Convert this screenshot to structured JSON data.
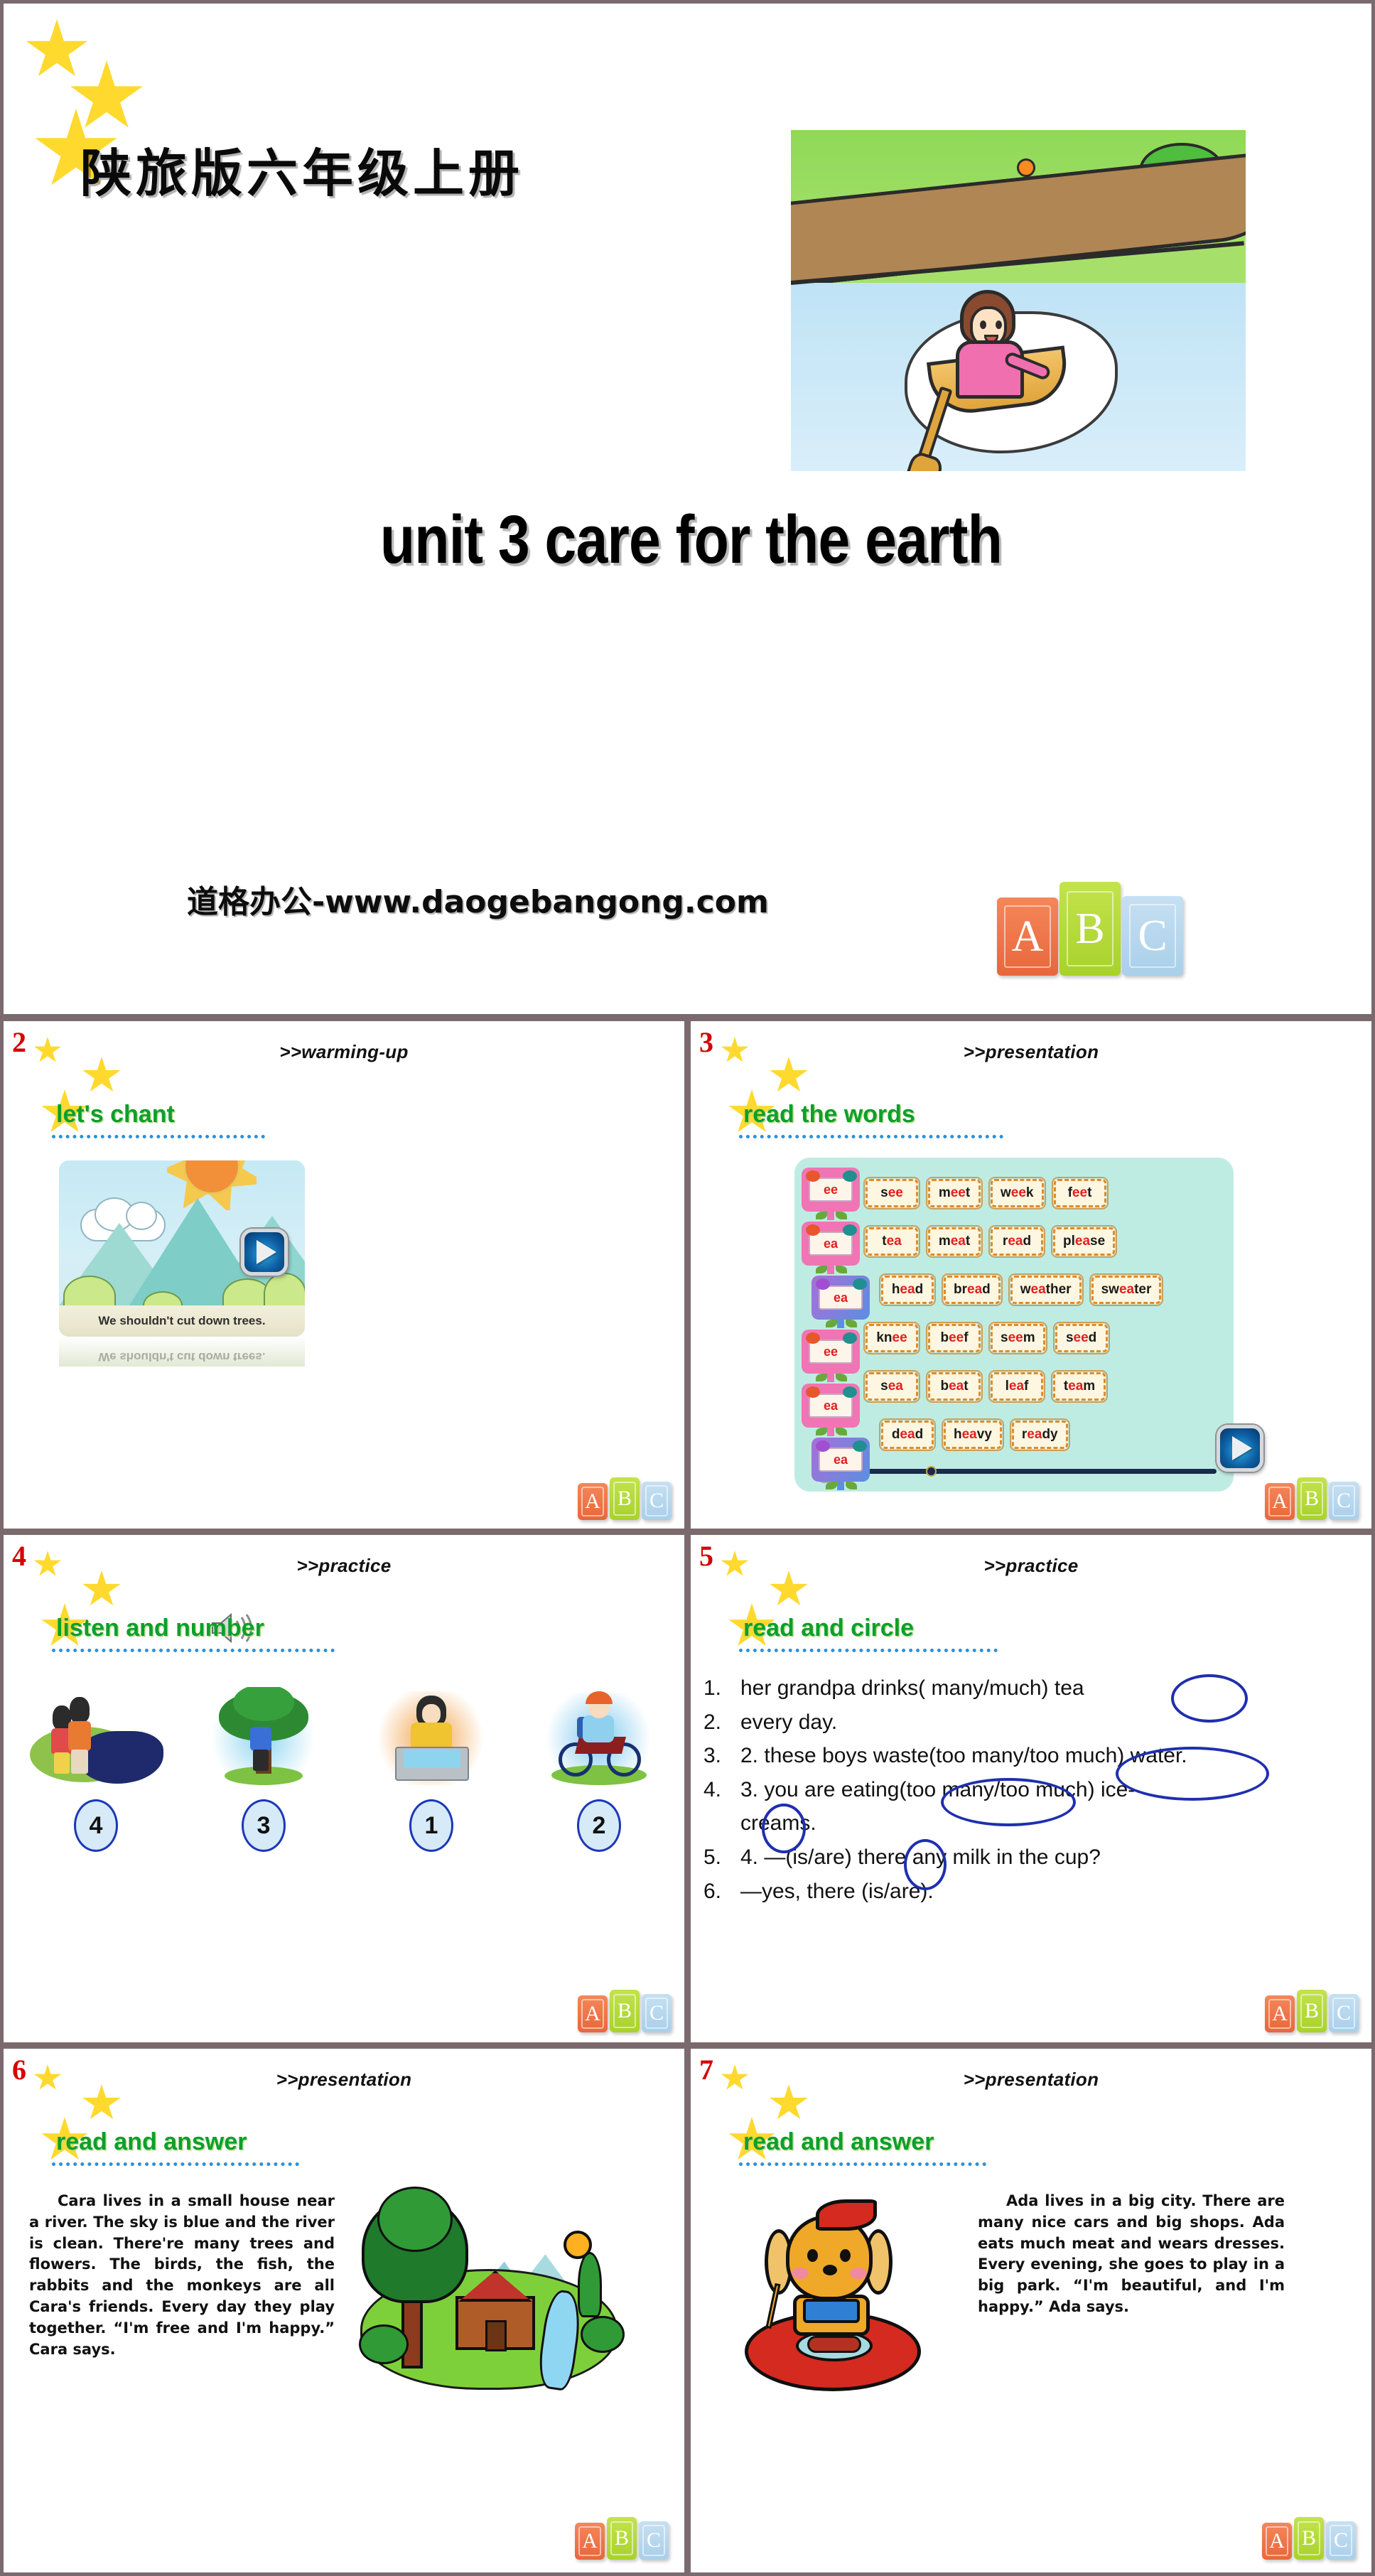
{
  "cover": {
    "series_label": "陕旅版六年级上册",
    "title": "unit 3 care for the earth",
    "watermark": "道格办公-www.daogebangong.com",
    "abc_blocks": [
      "A",
      "B",
      "C"
    ],
    "artwork_name": "girl-rowing-boat-on-river"
  },
  "colors": {
    "slide_border": "#7a6a6e",
    "heading_green": "#0aa02b",
    "slide_number_red": "#d60000",
    "underline_blue": "#2f8fd6",
    "circle_ink_blue": "#1f2fb0",
    "star_yellow": "#ffd92e",
    "word_board_bg": "#bfece2",
    "word_card_bg": "#fdf6e0",
    "word_card_border": "#e08b2a",
    "phoneme_red": "#e02020",
    "block_a": "#e8673b",
    "block_b": "#a8d22a",
    "block_c": "#a9cfea"
  },
  "slides": [
    {
      "number": "2",
      "section": ">>warming-up",
      "title": "let's chant",
      "picture_caption": "We shouldn't cut down trees.",
      "picture_name": "mountains-sun-cloud-trees-scene",
      "has_play_button": true
    },
    {
      "number": "3",
      "section": ">>presentation",
      "title": "read the words",
      "signs": [
        "ee",
        "ea",
        "ea",
        "ee",
        "ea",
        "ea"
      ],
      "word_rows": [
        [
          {
            "pre": "s",
            "hl": "ee",
            "post": ""
          },
          {
            "pre": "m",
            "hl": "ee",
            "post": "t"
          },
          {
            "pre": "w",
            "hl": "ee",
            "post": "k"
          },
          {
            "pre": "f",
            "hl": "ee",
            "post": "t"
          }
        ],
        [
          {
            "pre": "t",
            "hl": "ea",
            "post": ""
          },
          {
            "pre": "m",
            "hl": "ea",
            "post": "t"
          },
          {
            "pre": "r",
            "hl": "ea",
            "post": "d"
          },
          {
            "pre": "pl",
            "hl": "ea",
            "post": "se"
          }
        ],
        [
          {
            "pre": "h",
            "hl": "ea",
            "post": "d"
          },
          {
            "pre": "br",
            "hl": "ea",
            "post": "d"
          },
          {
            "pre": "w",
            "hl": "ea",
            "post": "ther"
          },
          {
            "pre": "sw",
            "hl": "ea",
            "post": "ter"
          }
        ],
        [
          {
            "pre": "kn",
            "hl": "ee",
            "post": ""
          },
          {
            "pre": "b",
            "hl": "ee",
            "post": "f"
          },
          {
            "pre": "s",
            "hl": "ee",
            "post": "m"
          },
          {
            "pre": "s",
            "hl": "ee",
            "post": "d"
          }
        ],
        [
          {
            "pre": "s",
            "hl": "ea",
            "post": ""
          },
          {
            "pre": "b",
            "hl": "ea",
            "post": "t"
          },
          {
            "pre": "l",
            "hl": "ea",
            "post": "f"
          },
          {
            "pre": "t",
            "hl": "ea",
            "post": "m"
          }
        ],
        [
          {
            "pre": "d",
            "hl": "ea",
            "post": "d"
          },
          {
            "pre": "h",
            "hl": "ea",
            "post": "vy"
          },
          {
            "pre": "r",
            "hl": "ea",
            "post": "dy"
          }
        ]
      ],
      "has_play_button": true,
      "has_progress_bar": true
    },
    {
      "number": "4",
      "section": ">>practice",
      "title": "listen and number",
      "has_speaker_icon": true,
      "items": [
        {
          "picture_name": "kids-beside-polluted-river",
          "answer": "4"
        },
        {
          "picture_name": "boy-cutting-down-tree",
          "answer": "3"
        },
        {
          "picture_name": "girl-wasting-water-at-sink",
          "answer": "1"
        },
        {
          "picture_name": "boy-riding-bicycle",
          "answer": "2"
        }
      ]
    },
    {
      "number": "5",
      "section": ">>practice",
      "title": "read and circle",
      "lines": [
        {
          "index": "1.",
          "text": "her grandpa drinks( many/much) tea"
        },
        {
          "index": "2.",
          "text": "    every day."
        },
        {
          "index": "3.",
          "text": "2. these boys waste(too many/too much) water."
        },
        {
          "index": "4.",
          "text": "3. you are eating(too many/too much) ice-"
        },
        {
          "index": "",
          "text": "creams."
        },
        {
          "index": "5.",
          "text": "4. —(is/are) there any milk in the cup?"
        },
        {
          "index": "6.",
          "text": "    —yes, there (is/are)."
        }
      ]
    },
    {
      "number": "6",
      "section": ">>presentation",
      "title": "read and answer",
      "passage": "Cara lives in a small house near a river. The sky is blue and the river is clean. There're many trees and flowers. The birds, the fish, the rabbits and the monkeys are all Cara's friends. Every day they play together. “I'm free and I'm happy.” Cara says.",
      "picture_name": "house-by-river-with-trees-and-animals"
    },
    {
      "number": "7",
      "section": ">>presentation",
      "title": "read and answer",
      "passage": "Ada lives in a big city. There are many nice cars and big shops. Ada eats much meat and wears dresses. Every evening, she goes to play in a big park. “I'm beautiful, and I'm happy.” Ada says.",
      "picture_name": "dog-girl-eating-meat-at-table"
    }
  ]
}
